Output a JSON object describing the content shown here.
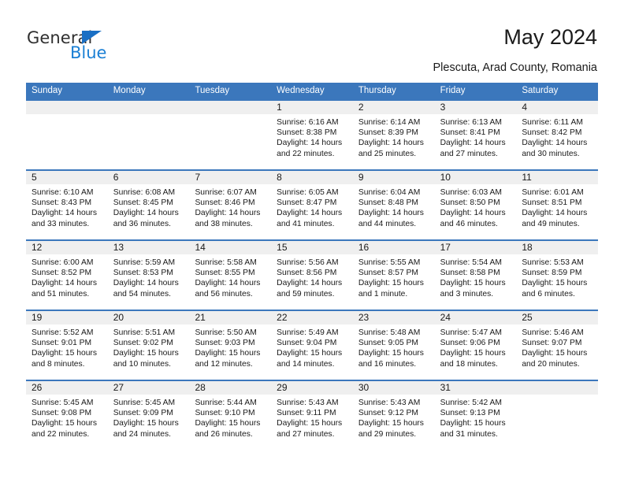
{
  "brand": {
    "name_part1": "General",
    "name_part2": "Blue",
    "accent_color": "#1a7fd4",
    "triangle_icon": "triangle-icon"
  },
  "header": {
    "title": "May 2024",
    "subtitle": "Plescuta, Arad County, Romania"
  },
  "calendar": {
    "header_bg": "#3b77bc",
    "weekdays": [
      "Sunday",
      "Monday",
      "Tuesday",
      "Wednesday",
      "Thursday",
      "Friday",
      "Saturday"
    ],
    "weeks": [
      [
        {
          "day": "",
          "sunrise": "",
          "sunset": "",
          "daylight": "",
          "empty": true
        },
        {
          "day": "",
          "sunrise": "",
          "sunset": "",
          "daylight": "",
          "empty": true
        },
        {
          "day": "",
          "sunrise": "",
          "sunset": "",
          "daylight": "",
          "empty": true
        },
        {
          "day": "1",
          "sunrise": "Sunrise: 6:16 AM",
          "sunset": "Sunset: 8:38 PM",
          "daylight": "Daylight: 14 hours and 22 minutes."
        },
        {
          "day": "2",
          "sunrise": "Sunrise: 6:14 AM",
          "sunset": "Sunset: 8:39 PM",
          "daylight": "Daylight: 14 hours and 25 minutes."
        },
        {
          "day": "3",
          "sunrise": "Sunrise: 6:13 AM",
          "sunset": "Sunset: 8:41 PM",
          "daylight": "Daylight: 14 hours and 27 minutes."
        },
        {
          "day": "4",
          "sunrise": "Sunrise: 6:11 AM",
          "sunset": "Sunset: 8:42 PM",
          "daylight": "Daylight: 14 hours and 30 minutes."
        }
      ],
      [
        {
          "day": "5",
          "sunrise": "Sunrise: 6:10 AM",
          "sunset": "Sunset: 8:43 PM",
          "daylight": "Daylight: 14 hours and 33 minutes."
        },
        {
          "day": "6",
          "sunrise": "Sunrise: 6:08 AM",
          "sunset": "Sunset: 8:45 PM",
          "daylight": "Daylight: 14 hours and 36 minutes."
        },
        {
          "day": "7",
          "sunrise": "Sunrise: 6:07 AM",
          "sunset": "Sunset: 8:46 PM",
          "daylight": "Daylight: 14 hours and 38 minutes."
        },
        {
          "day": "8",
          "sunrise": "Sunrise: 6:05 AM",
          "sunset": "Sunset: 8:47 PM",
          "daylight": "Daylight: 14 hours and 41 minutes."
        },
        {
          "day": "9",
          "sunrise": "Sunrise: 6:04 AM",
          "sunset": "Sunset: 8:48 PM",
          "daylight": "Daylight: 14 hours and 44 minutes."
        },
        {
          "day": "10",
          "sunrise": "Sunrise: 6:03 AM",
          "sunset": "Sunset: 8:50 PM",
          "daylight": "Daylight: 14 hours and 46 minutes."
        },
        {
          "day": "11",
          "sunrise": "Sunrise: 6:01 AM",
          "sunset": "Sunset: 8:51 PM",
          "daylight": "Daylight: 14 hours and 49 minutes."
        }
      ],
      [
        {
          "day": "12",
          "sunrise": "Sunrise: 6:00 AM",
          "sunset": "Sunset: 8:52 PM",
          "daylight": "Daylight: 14 hours and 51 minutes."
        },
        {
          "day": "13",
          "sunrise": "Sunrise: 5:59 AM",
          "sunset": "Sunset: 8:53 PM",
          "daylight": "Daylight: 14 hours and 54 minutes."
        },
        {
          "day": "14",
          "sunrise": "Sunrise: 5:58 AM",
          "sunset": "Sunset: 8:55 PM",
          "daylight": "Daylight: 14 hours and 56 minutes."
        },
        {
          "day": "15",
          "sunrise": "Sunrise: 5:56 AM",
          "sunset": "Sunset: 8:56 PM",
          "daylight": "Daylight: 14 hours and 59 minutes."
        },
        {
          "day": "16",
          "sunrise": "Sunrise: 5:55 AM",
          "sunset": "Sunset: 8:57 PM",
          "daylight": "Daylight: 15 hours and 1 minute."
        },
        {
          "day": "17",
          "sunrise": "Sunrise: 5:54 AM",
          "sunset": "Sunset: 8:58 PM",
          "daylight": "Daylight: 15 hours and 3 minutes."
        },
        {
          "day": "18",
          "sunrise": "Sunrise: 5:53 AM",
          "sunset": "Sunset: 8:59 PM",
          "daylight": "Daylight: 15 hours and 6 minutes."
        }
      ],
      [
        {
          "day": "19",
          "sunrise": "Sunrise: 5:52 AM",
          "sunset": "Sunset: 9:01 PM",
          "daylight": "Daylight: 15 hours and 8 minutes."
        },
        {
          "day": "20",
          "sunrise": "Sunrise: 5:51 AM",
          "sunset": "Sunset: 9:02 PM",
          "daylight": "Daylight: 15 hours and 10 minutes."
        },
        {
          "day": "21",
          "sunrise": "Sunrise: 5:50 AM",
          "sunset": "Sunset: 9:03 PM",
          "daylight": "Daylight: 15 hours and 12 minutes."
        },
        {
          "day": "22",
          "sunrise": "Sunrise: 5:49 AM",
          "sunset": "Sunset: 9:04 PM",
          "daylight": "Daylight: 15 hours and 14 minutes."
        },
        {
          "day": "23",
          "sunrise": "Sunrise: 5:48 AM",
          "sunset": "Sunset: 9:05 PM",
          "daylight": "Daylight: 15 hours and 16 minutes."
        },
        {
          "day": "24",
          "sunrise": "Sunrise: 5:47 AM",
          "sunset": "Sunset: 9:06 PM",
          "daylight": "Daylight: 15 hours and 18 minutes."
        },
        {
          "day": "25",
          "sunrise": "Sunrise: 5:46 AM",
          "sunset": "Sunset: 9:07 PM",
          "daylight": "Daylight: 15 hours and 20 minutes."
        }
      ],
      [
        {
          "day": "26",
          "sunrise": "Sunrise: 5:45 AM",
          "sunset": "Sunset: 9:08 PM",
          "daylight": "Daylight: 15 hours and 22 minutes."
        },
        {
          "day": "27",
          "sunrise": "Sunrise: 5:45 AM",
          "sunset": "Sunset: 9:09 PM",
          "daylight": "Daylight: 15 hours and 24 minutes."
        },
        {
          "day": "28",
          "sunrise": "Sunrise: 5:44 AM",
          "sunset": "Sunset: 9:10 PM",
          "daylight": "Daylight: 15 hours and 26 minutes."
        },
        {
          "day": "29",
          "sunrise": "Sunrise: 5:43 AM",
          "sunset": "Sunset: 9:11 PM",
          "daylight": "Daylight: 15 hours and 27 minutes."
        },
        {
          "day": "30",
          "sunrise": "Sunrise: 5:43 AM",
          "sunset": "Sunset: 9:12 PM",
          "daylight": "Daylight: 15 hours and 29 minutes."
        },
        {
          "day": "31",
          "sunrise": "Sunrise: 5:42 AM",
          "sunset": "Sunset: 9:13 PM",
          "daylight": "Daylight: 15 hours and 31 minutes."
        },
        {
          "day": "",
          "sunrise": "",
          "sunset": "",
          "daylight": "",
          "empty": true
        }
      ]
    ]
  }
}
